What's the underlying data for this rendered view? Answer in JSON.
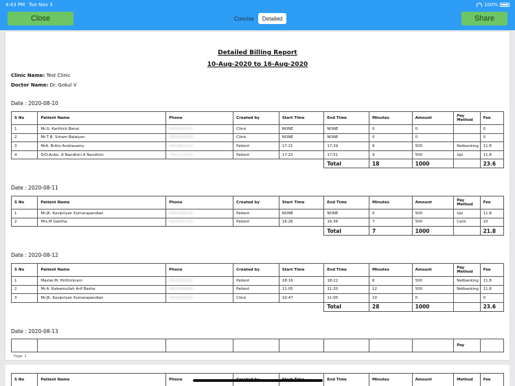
{
  "status": {
    "time": "4:43 PM",
    "date": "Tue Nov 3",
    "battery": "100%"
  },
  "nav": {
    "close": "Close",
    "share": "Share",
    "tabs": [
      "Concise",
      "Detailed"
    ],
    "active_tab": "Detailed"
  },
  "report": {
    "title": "Detailed Billing Report",
    "range": "10-Aug-2020 to 16-Aug-2020",
    "clinic_label": "Clinic Name:",
    "clinic": "Test Clinic",
    "doctor_label": "Doctor Name:",
    "doctor": "Dr. Gokul V",
    "headers": [
      "S No",
      "Patient Name",
      "Phone",
      "Created by",
      "Start Time",
      "End Time",
      "Minutes",
      "Amount",
      "Pay Method",
      "Fee"
    ],
    "total_label": "Total",
    "page_label": "Page: 1",
    "days": [
      {
        "date": "Date : 2020-08-10",
        "rows": [
          [
            "1",
            "Mr.G. Karthick Banal",
            "9000987197",
            "Clinic",
            "NONE",
            "NONE",
            "0",
            "0",
            "",
            "0"
          ],
          [
            "2",
            "Mr.T B. Sriram Balaiyan",
            "9884648656",
            "Clinic",
            "NONE",
            "NONE",
            "0",
            "0",
            "",
            "0"
          ],
          [
            "3",
            "MrA. Britto Arokiasamy",
            "9952861412",
            "Patient",
            "17:21",
            "17:29",
            "9",
            "500",
            "Netbanking",
            "11.8"
          ],
          [
            "4",
            "D/O.Anbu. A Nandhini A Nandhini",
            "7550313318",
            "Patient",
            "17:22",
            "17:51",
            "9",
            "500",
            "Upi",
            "11.8"
          ]
        ],
        "totals": {
          "minutes": "18",
          "amount": "1000",
          "fee": "23.6"
        }
      },
      {
        "date": "Date : 2020-08-11",
        "rows": [
          [
            "1",
            "Mr.JK. Kavipriyan Kumarapandian",
            "9944088328",
            "Patient",
            "NONE",
            "NONE",
            "0",
            "500",
            "Upi",
            "11.8"
          ],
          [
            "2",
            "Mrs.M Geetha",
            "9003087259",
            "Patient",
            "16:26",
            "16:36",
            "7",
            "500",
            "Card",
            "10"
          ]
        ],
        "totals": {
          "minutes": "7",
          "amount": "1000",
          "fee": "21.8"
        }
      },
      {
        "date": "Date : 2020-08-12",
        "rows": [
          [
            "1",
            "Master.M. Hrithickram",
            "9659630007",
            "Patient",
            "18:16",
            "18:22",
            "6",
            "500",
            "Netbanking",
            "11.8"
          ],
          [
            "2",
            "Mr.A. Kaleemullah Arif Basha",
            "9952448095",
            "Patient",
            "11:05",
            "11:20",
            "12",
            "500",
            "Netbanking",
            "11.8"
          ],
          [
            "3",
            "Mr.JK. Kavipriyan Kumarapandian",
            "9944088328",
            "Clinic",
            "10:47",
            "11:00",
            "10",
            "0",
            "",
            "0"
          ]
        ],
        "totals": {
          "minutes": "28",
          "amount": "1000",
          "fee": "23.6"
        }
      },
      {
        "date": "Date : 2020-08-13"
      }
    ]
  },
  "page2": {
    "headers": [
      "S No",
      "Patient Name",
      "Phone",
      "Created by",
      "Start Time",
      "End Time",
      "Minutes",
      "Amount",
      "Method",
      "Fee"
    ]
  }
}
